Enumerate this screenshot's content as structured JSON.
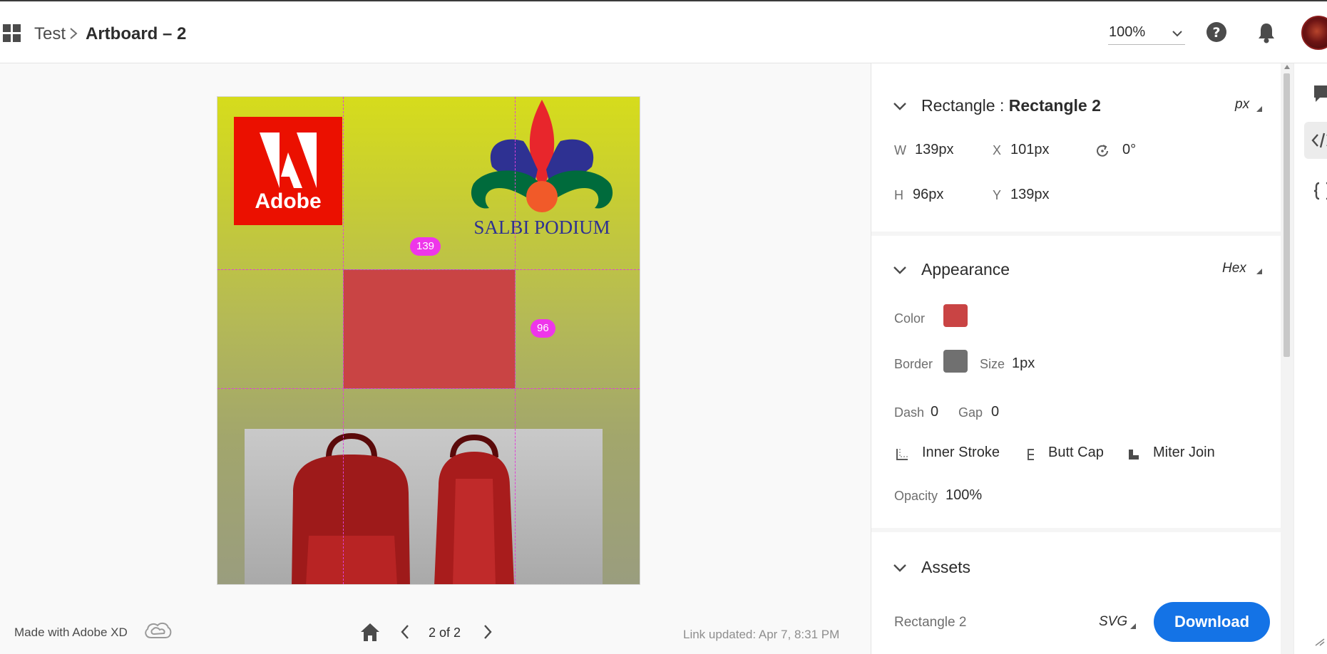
{
  "header": {
    "breadcrumb_parent": "Test",
    "breadcrumb_current": "Artboard – 2",
    "zoom": "100%"
  },
  "artboard": {
    "adobe_logo_text": "Adobe",
    "salbi_logo_text": "SALBI PODIUM",
    "measure_width": "139",
    "measure_height": "96"
  },
  "footer": {
    "made_with": "Made with Adobe XD",
    "page_indicator": "2 of 2",
    "link_updated": "Link updated: Apr 7, 8:31 PM"
  },
  "inspect": {
    "object_type": "Rectangle : ",
    "object_name": "Rectangle 2",
    "unit": "px",
    "w_label": "W",
    "w_value": "139px",
    "x_label": "X",
    "x_value": "101px",
    "rotation_value": "0°",
    "h_label": "H",
    "h_value": "96px",
    "y_label": "Y",
    "y_value": "139px"
  },
  "appearance": {
    "title": "Appearance",
    "color_mode": "Hex",
    "color_label": "Color",
    "color_value": "#c94444",
    "border_label": "Border",
    "border_color": "#707070",
    "size_label": "Size",
    "size_value": "1px",
    "dash_label": "Dash",
    "dash_value": "0",
    "gap_label": "Gap",
    "gap_value": "0",
    "stroke_position": "Inner Stroke",
    "cap": "Butt Cap",
    "join": "Miter Join",
    "opacity_label": "Opacity",
    "opacity_value": "100%"
  },
  "assets": {
    "title": "Assets",
    "asset_name": "Rectangle 2",
    "format": "SVG",
    "download_label": "Download"
  }
}
